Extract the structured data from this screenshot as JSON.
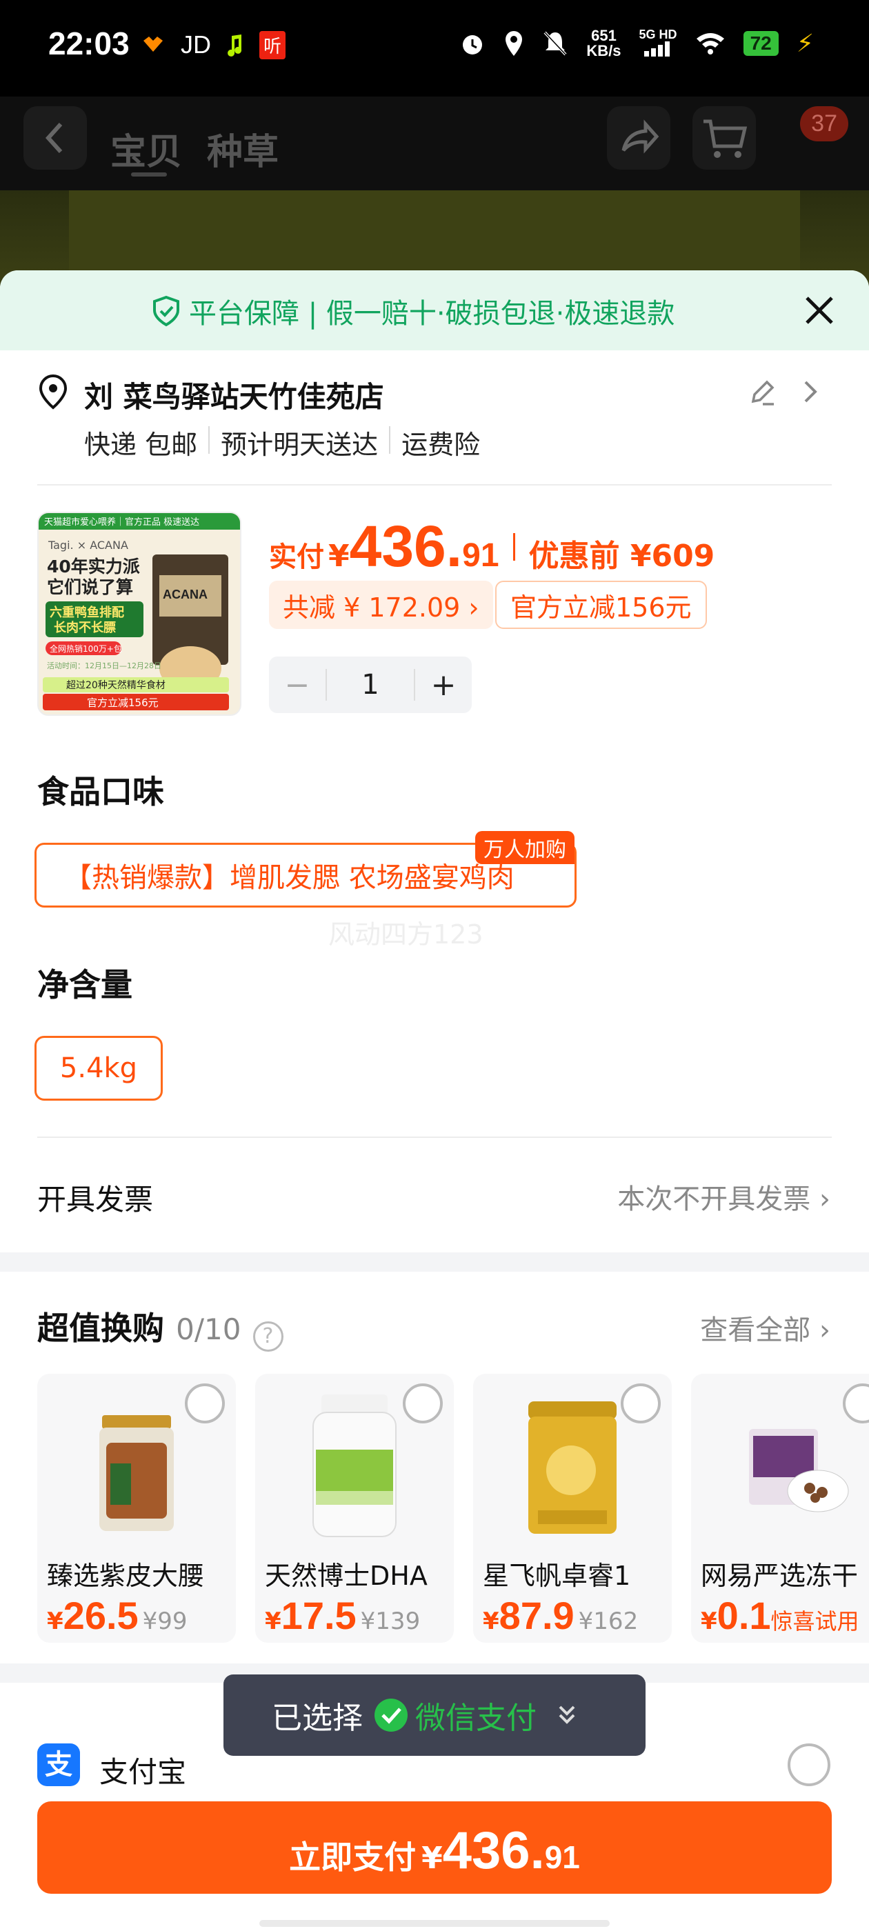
{
  "status_bar": {
    "time": "22:03",
    "jd": "JD",
    "ting": "听",
    "net_speed_value": "651",
    "net_speed_unit": "KB/s",
    "network_type": "5G HD",
    "battery": "72"
  },
  "header": {
    "tabs": [
      "宝贝",
      "种草"
    ],
    "cart_count": "37"
  },
  "guarantee": {
    "text": "平台保障 | 假一赔十·破损包退·极速退款"
  },
  "address": {
    "name": "刘 菜鸟驿站天竹佳苑店",
    "delivery": "快递 包邮",
    "eta": "预计明天送达",
    "insurance": "运费险"
  },
  "product": {
    "price_label": "实付",
    "currency": "¥",
    "price_int": "436.",
    "price_dec": "91",
    "before_label": "优惠前 ¥609",
    "discount_total": "共减 ¥ 172.09 ›",
    "official_discount": "官方立减156元",
    "quantity": "1",
    "minus": "−",
    "plus": "+"
  },
  "thumb_text": {
    "top_banner": "天猫超市爱心喂养｜官方正品 极速送达",
    "brand": "Tagi. × ACANA",
    "slogan1": "40年实力派",
    "slogan2": "它们说了算",
    "tag1": "六重鸭鱼排配",
    "tag2": "长肉不长膘",
    "gift": "全网热销100万+包",
    "date": "活动时间：12月15日—12月28日",
    "feature": "超过20种天然精华食材",
    "bottom": "官方立减156元"
  },
  "options": {
    "flavor_title": "食品口味",
    "flavor_value": "【热销爆款】增肌发腮 农场盛宴鸡肉",
    "flavor_badge": "万人加购",
    "watermark": "风动四方123",
    "weight_title": "净含量",
    "weight_value": "5.4kg"
  },
  "invoice": {
    "label": "开具发票",
    "value": "本次不开具发票 ›"
  },
  "exchange": {
    "title": "超值换购",
    "count": "0/10",
    "help": "?",
    "view_all": "查看全部 ›",
    "items": [
      {
        "name": "臻选紫皮大腰",
        "currency": "¥",
        "price": "26.5",
        "orig": "¥99",
        "tag": ""
      },
      {
        "name": "天然博士DHA",
        "currency": "¥",
        "price": "17.5",
        "orig": "¥139",
        "tag": ""
      },
      {
        "name": "星飞帆卓睿1",
        "currency": "¥",
        "price": "87.9",
        "orig": "¥162",
        "tag": ""
      },
      {
        "name": "网易严选冻干",
        "currency": "¥",
        "price": "0.1",
        "orig": "",
        "tag": "惊喜试用"
      }
    ]
  },
  "payment": {
    "toast_label": "已选择",
    "toast_method": "微信支付",
    "alipay_icon_char": "支",
    "alipay_label": "支付宝",
    "pay_label": "立即支付",
    "pay_currency": "¥",
    "pay_int": "436.",
    "pay_dec": "91"
  },
  "colors": {
    "accent": "#ff4d0a",
    "guarantee_green": "#11a45e",
    "wechat_green": "#27c04a",
    "alipay_blue": "#1677ff"
  },
  "icons": [
    "back-arrow-icon",
    "share-icon",
    "cart-icon",
    "shield-check-icon",
    "close-icon",
    "location-pin-icon",
    "edit-pencil-icon",
    "chevron-right-icon",
    "help-circle-icon",
    "wechat-check-icon",
    "chevron-double-down-icon",
    "alipay-icon"
  ]
}
